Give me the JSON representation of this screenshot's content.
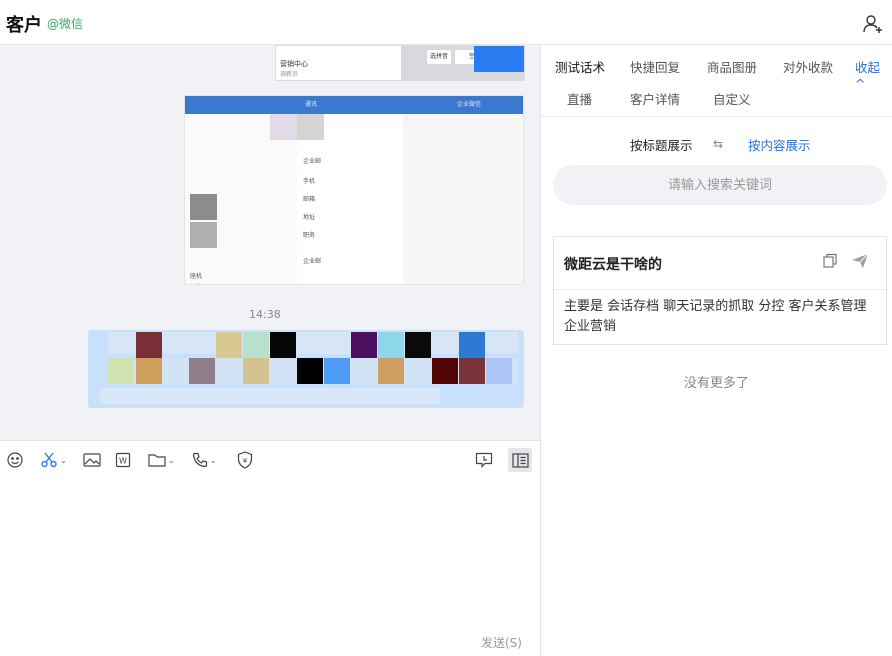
{
  "header": {
    "title": "客户",
    "source": "@微信"
  },
  "chat": {
    "top_image": {
      "line1": "营销中心",
      "line2": "调教员",
      "key1": "选拼音",
      "key2": "空格"
    },
    "image": {
      "bar_text": "企业微信",
      "back_label": "通讯",
      "items": [
        "企业邮",
        "手机",
        "邮箱",
        "地址",
        "职务",
        "企业邮"
      ],
      "left_labels": [
        "座机",
        "邮箱"
      ]
    },
    "time": "14:38",
    "colors": {
      "bubble": "#c8e0fb",
      "chat_bg": "#f1f2f5"
    }
  },
  "composer": {
    "send_label": "发送(S)",
    "icons": [
      "emoji-icon",
      "scissors-icon",
      "image-icon",
      "word-icon",
      "folder-icon",
      "phone-icon",
      "shield-icon",
      "chat-record-icon",
      "side-panel-icon"
    ]
  },
  "right_panel": {
    "tabs": [
      {
        "label": "测试话术",
        "active": true
      },
      {
        "label": "快捷回复"
      },
      {
        "label": "商品图册"
      },
      {
        "label": "对外收款"
      },
      {
        "label": "收起 ^"
      },
      {
        "label": "直播"
      },
      {
        "label": "客户详情"
      },
      {
        "label": "自定义"
      }
    ],
    "display_by_title": "按标题展示",
    "swap_icon": "⇆",
    "display_by_content": "按内容展示",
    "search_placeholder": "请输入搜索关键词",
    "card": {
      "title": "微距云是干啥的",
      "body": "主要是 会话存档 聊天记录的抓取 分控 客户关系管理 企业营销"
    },
    "no_more": "没有更多了",
    "accent": "#2a6fd6"
  }
}
